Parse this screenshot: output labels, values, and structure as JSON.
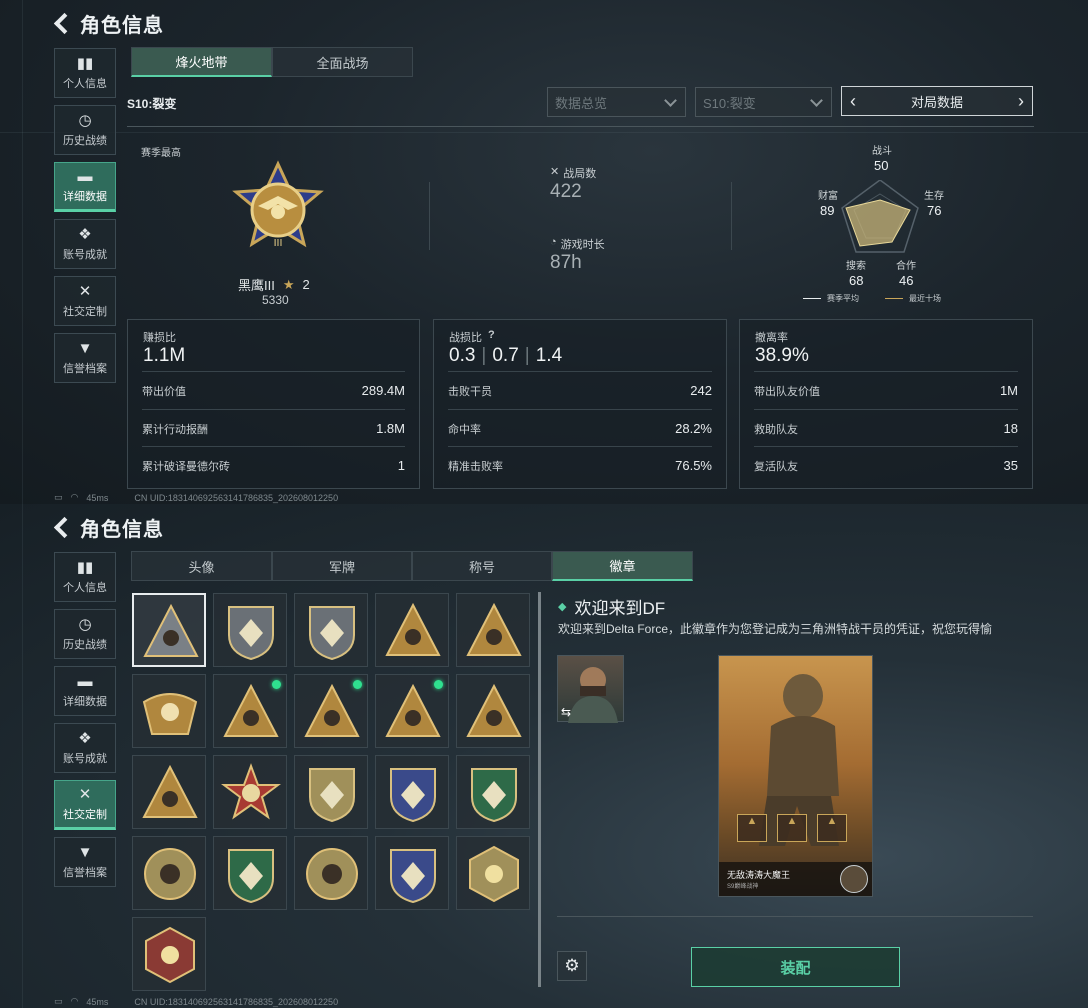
{
  "screen1": {
    "title": "角色信息",
    "sidebar": [
      {
        "label": "个人信息",
        "icon": "bar-chart-icon"
      },
      {
        "label": "历史战绩",
        "icon": "clock-icon"
      },
      {
        "label": "详细数据",
        "icon": "folder-icon",
        "active": true
      },
      {
        "label": "账号成就",
        "icon": "achievement-icon"
      },
      {
        "label": "社交定制",
        "icon": "tools-icon"
      },
      {
        "label": "信誉档案",
        "icon": "shield-icon"
      }
    ],
    "tabs": [
      "烽火地带",
      "全面战场"
    ],
    "season_label": "S10:裂变",
    "filter1": "数据总览",
    "filter2": "S10:裂变",
    "pager_label": "对局数据",
    "season_best_label": "赛季最高",
    "rank_name": "黑鹰III",
    "rank_stars": "2",
    "rank_points": "5330",
    "battles_label": "战局数",
    "battles_value": "422",
    "playtime_label": "游戏时长",
    "playtime_value": "87h",
    "radar": {
      "combat_label": "战斗",
      "combat": "50",
      "survive_label": "生存",
      "survive": "76",
      "coop_label": "合作",
      "coop": "46",
      "search_label": "搜索",
      "search": "68",
      "wealth_label": "财富",
      "wealth": "89",
      "legend_avg": "赛季平均",
      "legend_recent": "最近十场"
    },
    "card1": {
      "label": "赚损比",
      "value": "1.1M",
      "rows": [
        [
          "带出价值",
          "289.4M"
        ],
        [
          "累计行动报酬",
          "1.8M"
        ],
        [
          "累计破译曼德尔砖",
          "1"
        ]
      ]
    },
    "card2": {
      "label": "战损比",
      "help": "?",
      "v1": "0.3",
      "v2": "0.7",
      "v3": "1.4",
      "rows": [
        [
          "击败干员",
          "242"
        ],
        [
          "命中率",
          "28.2%"
        ],
        [
          "精准击败率",
          "76.5%"
        ]
      ]
    },
    "card3": {
      "label": "撤离率",
      "value": "38.9%",
      "rows": [
        [
          "带出队友价值",
          "1M"
        ],
        [
          "救助队友",
          "18"
        ],
        [
          "复活队友",
          "35"
        ]
      ]
    },
    "status_ping": "45ms",
    "status_uid": "CN UID:1831406925631417868​35_202608012250"
  },
  "screen2": {
    "title": "角色信息",
    "sidebar": [
      {
        "label": "个人信息"
      },
      {
        "label": "历史战绩"
      },
      {
        "label": "详细数据"
      },
      {
        "label": "账号成就"
      },
      {
        "label": "社交定制",
        "active": true
      },
      {
        "label": "信誉档案"
      }
    ],
    "tabs": [
      "头像",
      "军牌",
      "称号",
      "徽章"
    ],
    "badge_title": "欢迎来到DF",
    "badge_desc": "欢迎来到Delta Force，此徽章作为您登记成为三角洲特战干员的凭证，祝您玩得愉",
    "player_name": "无敌涛涛大魔王",
    "player_sub": "S9巅峰战神",
    "equip_label": "装配",
    "status_ping": "45ms",
    "status_uid": "CN UID:1831406925631417868​35_202608012250"
  },
  "colors": {
    "accent": "#5ad0a6",
    "active_tab": "#3a5a50",
    "gold": "#c9a659"
  }
}
